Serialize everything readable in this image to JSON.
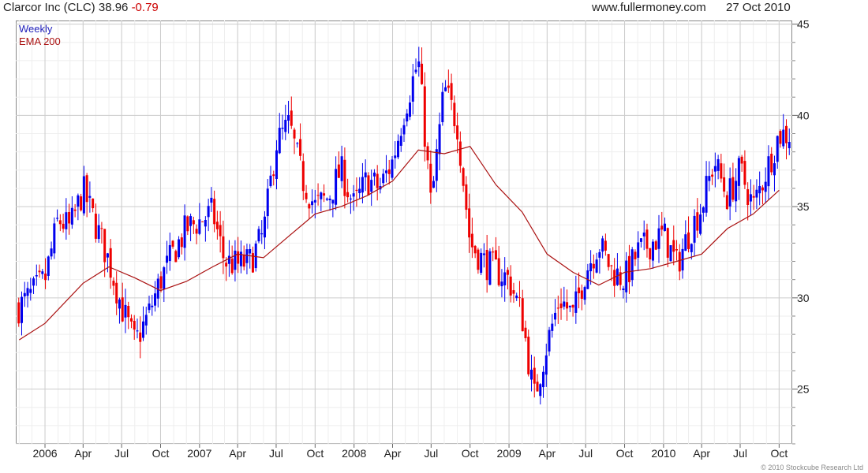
{
  "header": {
    "title": "Clarcor Inc (CLC) 38.96",
    "change": "-0.79",
    "website": "www.fullermoney.com",
    "date": "27 Oct 2010"
  },
  "legend": {
    "series1": "Weekly",
    "series2": "EMA 200"
  },
  "copyright": "© 2010 Stockcube Research Ltd",
  "colors": {
    "up": "#0000ee",
    "down": "#ee0000",
    "ema": "#aa1111",
    "grid": "#cccccc",
    "frame": "#888888"
  },
  "chart_data": {
    "type": "candlestick",
    "title": "Clarcor Inc (CLC) 38.96 -0.79",
    "ylim": [
      22,
      45.2
    ],
    "y_ticks": [
      25,
      30,
      35,
      40,
      45
    ],
    "y_axis_position": "right",
    "x_ticks": [
      {
        "label": "2006",
        "date": "2006-01"
      },
      {
        "label": "Apr",
        "date": "2006-04"
      },
      {
        "label": "Jul",
        "date": "2006-07"
      },
      {
        "label": "Oct",
        "date": "2006-10"
      },
      {
        "label": "2007",
        "date": "2007-01"
      },
      {
        "label": "Apr",
        "date": "2007-04"
      },
      {
        "label": "Jul",
        "date": "2007-07"
      },
      {
        "label": "Oct",
        "date": "2007-10"
      },
      {
        "label": "2008",
        "date": "2008-01"
      },
      {
        "label": "Apr",
        "date": "2008-04"
      },
      {
        "label": "Jul",
        "date": "2008-07"
      },
      {
        "label": "Oct",
        "date": "2008-10"
      },
      {
        "label": "2009",
        "date": "2009-01"
      },
      {
        "label": "Apr",
        "date": "2009-04"
      },
      {
        "label": "Jul",
        "date": "2009-07"
      },
      {
        "label": "Oct",
        "date": "2009-10"
      },
      {
        "label": "2010",
        "date": "2010-01"
      },
      {
        "label": "Apr",
        "date": "2010-04"
      },
      {
        "label": "Jul",
        "date": "2010-07"
      },
      {
        "label": "Oct",
        "date": "2010-10"
      }
    ],
    "x_range": [
      "2005-10-24",
      "2010-11-01"
    ],
    "grid": true,
    "legend_position": "top-left",
    "weekly_close": [
      {
        "date": "2005-11",
        "close": 29.5
      },
      {
        "date": "2005-12",
        "close": 30.2
      },
      {
        "date": "2006-01",
        "close": 31.0
      },
      {
        "date": "2006-02",
        "close": 34.3
      },
      {
        "date": "2006-03",
        "close": 33.8
      },
      {
        "date": "2006-04",
        "close": 35.9
      },
      {
        "date": "2006-05",
        "close": 34.0
      },
      {
        "date": "2006-06",
        "close": 32.0
      },
      {
        "date": "2006-07",
        "close": 29.5
      },
      {
        "date": "2006-08",
        "close": 27.5
      },
      {
        "date": "2006-09",
        "close": 29.0
      },
      {
        "date": "2006-10",
        "close": 31.0
      },
      {
        "date": "2006-11",
        "close": 32.5
      },
      {
        "date": "2006-12",
        "close": 33.8
      },
      {
        "date": "2007-01",
        "close": 34.2
      },
      {
        "date": "2007-02",
        "close": 34.7
      },
      {
        "date": "2007-03",
        "close": 32.0
      },
      {
        "date": "2007-04",
        "close": 31.8
      },
      {
        "date": "2007-05",
        "close": 32.0
      },
      {
        "date": "2007-06",
        "close": 33.5
      },
      {
        "date": "2007-07",
        "close": 38.5
      },
      {
        "date": "2007-08",
        "close": 39.5
      },
      {
        "date": "2007-09",
        "close": 36.5
      },
      {
        "date": "2007-10",
        "close": 35.0
      },
      {
        "date": "2007-11",
        "close": 35.5
      },
      {
        "date": "2007-12",
        "close": 37.0
      },
      {
        "date": "2008-01",
        "close": 35.0
      },
      {
        "date": "2008-02",
        "close": 36.5
      },
      {
        "date": "2008-03",
        "close": 36.0
      },
      {
        "date": "2008-04",
        "close": 37.5
      },
      {
        "date": "2008-05",
        "close": 40.5
      },
      {
        "date": "2008-06",
        "close": 43.0
      },
      {
        "date": "2008-07",
        "close": 35.0
      },
      {
        "date": "2008-08",
        "close": 41.5
      },
      {
        "date": "2008-09",
        "close": 39.5
      },
      {
        "date": "2008-10",
        "close": 33.0
      },
      {
        "date": "2008-11",
        "close": 32.0
      },
      {
        "date": "2008-12",
        "close": 31.5
      },
      {
        "date": "2009-01",
        "close": 31.0
      },
      {
        "date": "2009-02",
        "close": 29.0
      },
      {
        "date": "2009-03",
        "close": 24.5
      },
      {
        "date": "2009-04",
        "close": 27.5
      },
      {
        "date": "2009-05",
        "close": 30.0
      },
      {
        "date": "2009-06",
        "close": 29.0
      },
      {
        "date": "2009-07",
        "close": 31.5
      },
      {
        "date": "2009-08",
        "close": 33.0
      },
      {
        "date": "2009-09",
        "close": 31.5
      },
      {
        "date": "2009-10",
        "close": 31.0
      },
      {
        "date": "2009-11",
        "close": 32.5
      },
      {
        "date": "2009-12",
        "close": 33.0
      },
      {
        "date": "2010-01",
        "close": 33.5
      },
      {
        "date": "2010-02",
        "close": 31.8
      },
      {
        "date": "2010-03",
        "close": 33.5
      },
      {
        "date": "2010-04",
        "close": 35.0
      },
      {
        "date": "2010-05",
        "close": 37.5
      },
      {
        "date": "2010-06",
        "close": 35.5
      },
      {
        "date": "2010-07",
        "close": 37.0
      },
      {
        "date": "2010-08",
        "close": 35.0
      },
      {
        "date": "2010-09",
        "close": 37.0
      },
      {
        "date": "2010-10",
        "close": 38.96
      }
    ],
    "ema200": [
      {
        "date": "2005-11",
        "value": 27.7
      },
      {
        "date": "2006-01",
        "value": 28.6
      },
      {
        "date": "2006-04",
        "value": 30.8
      },
      {
        "date": "2006-06",
        "value": 31.7
      },
      {
        "date": "2006-08",
        "value": 31.1
      },
      {
        "date": "2006-10",
        "value": 30.4
      },
      {
        "date": "2006-12",
        "value": 30.9
      },
      {
        "date": "2007-02",
        "value": 31.7
      },
      {
        "date": "2007-04",
        "value": 32.4
      },
      {
        "date": "2007-06",
        "value": 32.2
      },
      {
        "date": "2007-08",
        "value": 33.4
      },
      {
        "date": "2007-10",
        "value": 34.6
      },
      {
        "date": "2007-12",
        "value": 35.0
      },
      {
        "date": "2008-02",
        "value": 35.6
      },
      {
        "date": "2008-04",
        "value": 36.4
      },
      {
        "date": "2008-06",
        "value": 38.1
      },
      {
        "date": "2008-08",
        "value": 37.9
      },
      {
        "date": "2008-10",
        "value": 38.3
      },
      {
        "date": "2008-12",
        "value": 36.2
      },
      {
        "date": "2009-02",
        "value": 34.7
      },
      {
        "date": "2009-04",
        "value": 32.4
      },
      {
        "date": "2009-06",
        "value": 31.4
      },
      {
        "date": "2009-08",
        "value": 30.7
      },
      {
        "date": "2009-10",
        "value": 31.4
      },
      {
        "date": "2009-12",
        "value": 31.6
      },
      {
        "date": "2010-02",
        "value": 32.0
      },
      {
        "date": "2010-04",
        "value": 32.4
      },
      {
        "date": "2010-06",
        "value": 33.8
      },
      {
        "date": "2010-08",
        "value": 34.6
      },
      {
        "date": "2010-10",
        "value": 35.9
      }
    ]
  }
}
